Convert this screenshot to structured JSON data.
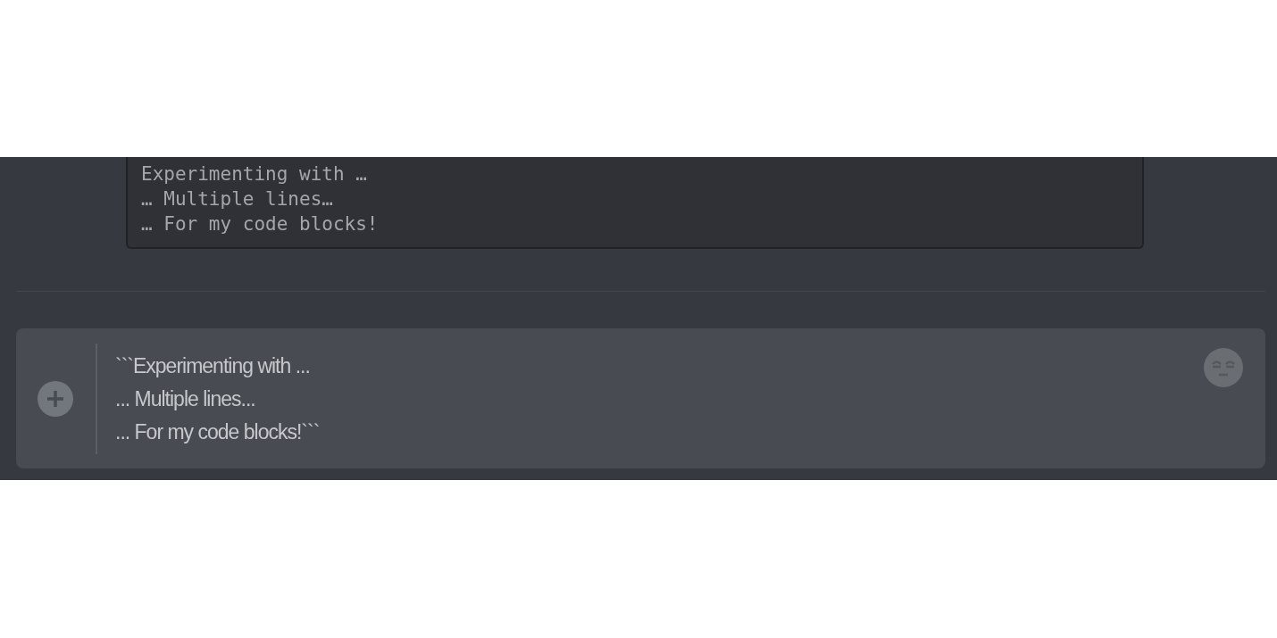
{
  "code_block": {
    "lines": [
      "Experimenting with …",
      "… Multiple lines…",
      "… For my code blocks!"
    ]
  },
  "message_input": {
    "value": "```Experimenting with ...\n... Multiple lines...\n... For my code blocks!```"
  }
}
